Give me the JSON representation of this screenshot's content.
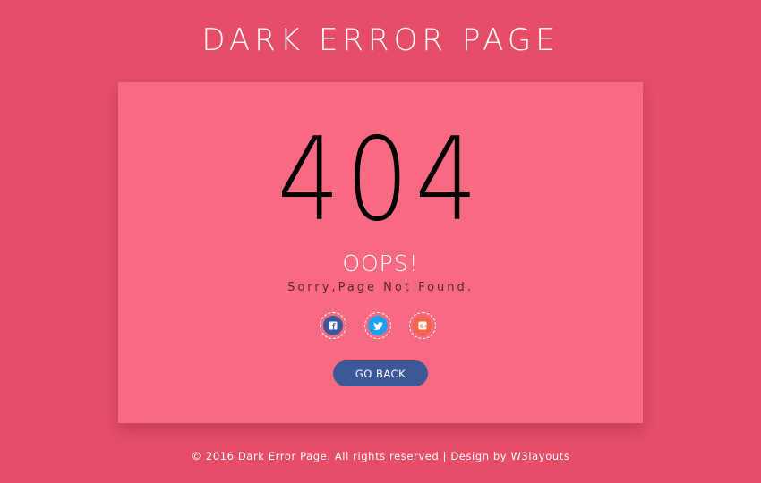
{
  "header": {
    "title": "DARK ERROR PAGE"
  },
  "card": {
    "error_code": "404",
    "heading": "OOPS!",
    "message": "Sorry,Page Not Found.",
    "social": [
      {
        "icon": "facebook-icon",
        "color": "#3b5998"
      },
      {
        "icon": "twitter-icon",
        "color": "#1da1f2"
      },
      {
        "icon": "google-plus-icon",
        "color": "#f4664a"
      }
    ],
    "go_back_label": "GO BACK"
  },
  "footer": {
    "text": "© 2016 Dark Error Page. All rights reserved | Design by W3layouts"
  },
  "colors": {
    "page_background": "#e54d69",
    "card_background": "#f86a82",
    "button_background": "#3b5998",
    "text_light": "#ffffff",
    "text_dark": "#000000"
  }
}
